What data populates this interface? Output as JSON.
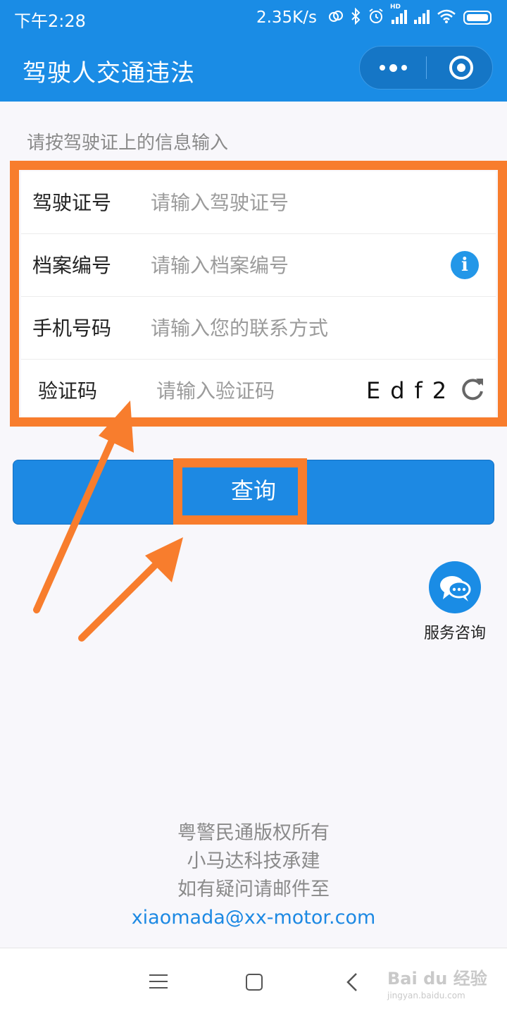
{
  "status_bar": {
    "time": "下午2:28",
    "speed": "2.35K/s",
    "icons": [
      "sync-icon",
      "bluetooth-icon",
      "alarm-icon",
      "hd-signal-icon",
      "signal-icon",
      "wifi-icon",
      "battery-icon"
    ],
    "hd": "HD"
  },
  "header": {
    "title": "驾驶人交通违法",
    "capsule_icons": [
      "more-icon",
      "close-miniprogram-icon"
    ]
  },
  "form": {
    "hint": "请按驾驶证上的信息输入",
    "fields": [
      {
        "label": "驾驶证号",
        "placeholder": "请输入驾驶证号",
        "value": ""
      },
      {
        "label": "档案编号",
        "placeholder": "请输入档案编号",
        "value": "",
        "icon": "info-icon",
        "icon_glyph": "i"
      },
      {
        "label": "手机号码",
        "placeholder": "请输入您的联系方式",
        "value": ""
      },
      {
        "label": "验证码",
        "placeholder": "请输入验证码",
        "value": "",
        "captcha": "Edf2",
        "icon": "refresh-icon"
      }
    ]
  },
  "query_button": {
    "label": "查询"
  },
  "service": {
    "label": "服务咨询",
    "icon": "chat-bubbles-icon"
  },
  "footer": {
    "lines": [
      "粤警民通版权所有",
      "小马达科技承建",
      "如有疑问请邮件至"
    ],
    "email": "xiaomada@xx-motor.com"
  },
  "nav_bar": {
    "icons": [
      "menu-icon",
      "home-icon",
      "back-icon"
    ]
  },
  "watermark": {
    "text": "Bai du 经验",
    "sub": "jingyan.baidu.com"
  },
  "colors": {
    "primary": "#1a8ce5",
    "annotation": "#f87d2d",
    "background": "#f8f7fb"
  }
}
